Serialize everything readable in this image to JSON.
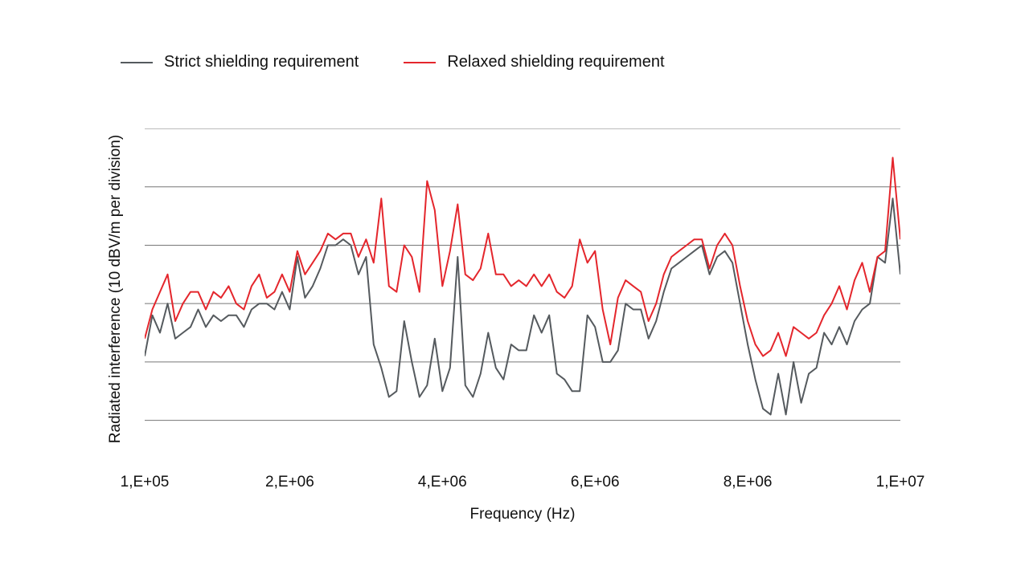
{
  "chart_data": {
    "type": "line",
    "xlabel": "Frequency (Hz)",
    "ylabel": "Radiated interference (10 dBV/m per division)",
    "ylim": [
      0,
      55
    ],
    "grid_y": [
      5,
      15,
      25,
      35,
      45,
      55
    ],
    "x_ticks": [
      {
        "label": "1,E+05",
        "x": 100000
      },
      {
        "label": "2,E+06",
        "x": 2000000
      },
      {
        "label": "4,E+06",
        "x": 4000000
      },
      {
        "label": "6,E+06",
        "x": 6000000
      },
      {
        "label": "8,E+06",
        "x": 8000000
      },
      {
        "label": "1,E+07",
        "x": 10000000
      }
    ],
    "x": [
      100000,
      200000,
      300000,
      400000,
      500000,
      600000,
      700000,
      800000,
      900000,
      1000000,
      1100000,
      1200000,
      1300000,
      1400000,
      1500000,
      1600000,
      1700000,
      1800000,
      1900000,
      2000000,
      2100000,
      2200000,
      2300000,
      2400000,
      2500000,
      2600000,
      2700000,
      2800000,
      2900000,
      3000000,
      3100000,
      3200000,
      3300000,
      3400000,
      3500000,
      3600000,
      3700000,
      3800000,
      3900000,
      4000000,
      4100000,
      4200000,
      4300000,
      4400000,
      4500000,
      4600000,
      4700000,
      4800000,
      4900000,
      5000000,
      5100000,
      5200000,
      5300000,
      5400000,
      5500000,
      5600000,
      5700000,
      5800000,
      5900000,
      6000000,
      6100000,
      6200000,
      6300000,
      6400000,
      6500000,
      6600000,
      6700000,
      6800000,
      6900000,
      7000000,
      7100000,
      7200000,
      7300000,
      7400000,
      7500000,
      7600000,
      7700000,
      7800000,
      7900000,
      8000000,
      8100000,
      8200000,
      8300000,
      8400000,
      8500000,
      8600000,
      8700000,
      8800000,
      8900000,
      9000000,
      9100000,
      9200000,
      9300000,
      9400000,
      9500000,
      9600000,
      9700000,
      9800000,
      9900000,
      10000000
    ],
    "series": [
      {
        "name": "Strict shielding requirement",
        "color": "#555a5e",
        "values": [
          16,
          23,
          20,
          25,
          19,
          20,
          21,
          24,
          21,
          23,
          22,
          23,
          23,
          21,
          24,
          25,
          25,
          24,
          27,
          24,
          33,
          26,
          28,
          31,
          35,
          35,
          36,
          35,
          30,
          33,
          18,
          14,
          9,
          10,
          22,
          15,
          9,
          11,
          19,
          10,
          14,
          33,
          11,
          9,
          13,
          20,
          14,
          12,
          18,
          17,
          17,
          23,
          20,
          23,
          13,
          12,
          10,
          10,
          23,
          21,
          15,
          15,
          17,
          25,
          24,
          24,
          19,
          22,
          27,
          31,
          32,
          33,
          34,
          35,
          30,
          33,
          34,
          32,
          25,
          18,
          12,
          7,
          6,
          13,
          6,
          15,
          8,
          13,
          14,
          20,
          18,
          21,
          18,
          22,
          24,
          25,
          33,
          32,
          43,
          30
        ]
      },
      {
        "name": "Relaxed shielding requirement",
        "color": "#e4262c",
        "values": [
          19,
          24,
          27,
          30,
          22,
          25,
          27,
          27,
          24,
          27,
          26,
          28,
          25,
          24,
          28,
          30,
          26,
          27,
          30,
          27,
          34,
          30,
          32,
          34,
          37,
          36,
          37,
          37,
          33,
          36,
          32,
          43,
          28,
          27,
          35,
          33,
          27,
          46,
          41,
          28,
          34,
          42,
          30,
          29,
          31,
          37,
          30,
          30,
          28,
          29,
          28,
          30,
          28,
          30,
          27,
          26,
          28,
          36,
          32,
          34,
          24,
          18,
          26,
          29,
          28,
          27,
          22,
          25,
          30,
          33,
          34,
          35,
          36,
          36,
          31,
          35,
          37,
          35,
          28,
          22,
          18,
          16,
          17,
          20,
          16,
          21,
          20,
          19,
          20,
          23,
          25,
          28,
          24,
          29,
          32,
          27,
          33,
          34,
          50,
          36
        ]
      }
    ]
  },
  "legend": {
    "strict": "Strict shielding requirement",
    "relaxed": "Relaxed shielding requirement"
  }
}
